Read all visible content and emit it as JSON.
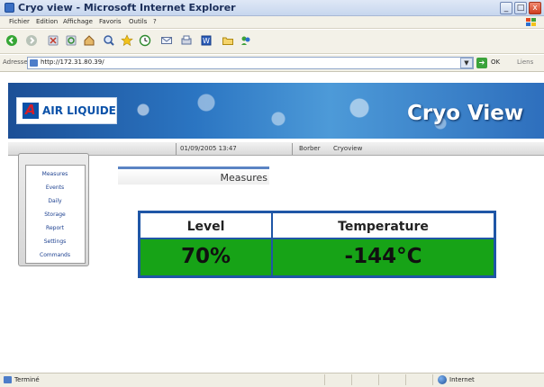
{
  "window": {
    "title": "Cryo view - Microsoft Internet Explorer"
  },
  "menu": [
    "Fichier",
    "Edition",
    "Affichage",
    "Favoris",
    "Outils",
    "?"
  ],
  "address": {
    "label": "Adresse",
    "url": "http://172.31.80.39/",
    "go_label": "OK",
    "links_label": "Liens"
  },
  "banner": {
    "logo_text": "AIR LIQUIDE",
    "logo_mark": "A",
    "app_name": "Cryo View"
  },
  "infobar": {
    "datetime": "01/09/2005 13:47",
    "user": "Borber",
    "site": "Cryoview"
  },
  "sidebar": {
    "items": [
      "Measures",
      "Events",
      "Daily",
      "Storage",
      "Report",
      "Settings",
      "Commands"
    ]
  },
  "section": {
    "title": "Measures"
  },
  "measures": {
    "headers": [
      "Level",
      "Temperature"
    ],
    "values": [
      "70%",
      "-144°C"
    ]
  },
  "status": {
    "text": "Terminé",
    "zone": "Internet"
  },
  "colors": {
    "value_cell": "#17a317",
    "table_border": "#1f56a6",
    "link": "#1b3f8f"
  }
}
